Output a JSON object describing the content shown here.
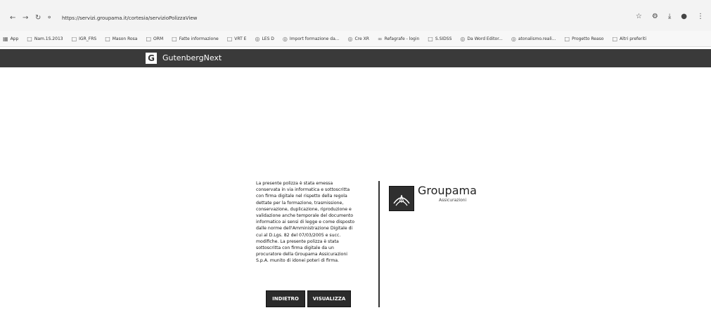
{
  "browser": {
    "url": "https://servizi.groupama.it/cortesia/servizioPolizzaView",
    "bookmarks": [
      {
        "icon": "apps-grid-icon",
        "label": "App"
      },
      {
        "icon": "folder-icon",
        "label": "Nam.1S.2013"
      },
      {
        "icon": "folder-icon",
        "label": "IGR_FRS"
      },
      {
        "icon": "folder-icon",
        "label": "Mason Rosa"
      },
      {
        "icon": "folder-icon",
        "label": "ORM"
      },
      {
        "icon": "folder-icon",
        "label": "Fatte informazione"
      },
      {
        "icon": "folder-icon",
        "label": "VRT E"
      },
      {
        "icon": "globe-icon",
        "label": "LES D"
      },
      {
        "icon": "globe-icon",
        "label": "Import formazione da..."
      },
      {
        "icon": "globe-icon",
        "label": "Cre XR"
      },
      {
        "icon": "link-icon",
        "label": "Refagrafe - login"
      },
      {
        "icon": "folder-icon",
        "label": "S.SIDSS"
      },
      {
        "icon": "globe-icon",
        "label": "Da Word Editor..."
      },
      {
        "icon": "globe-icon",
        "label": "atonalismo.reali..."
      },
      {
        "icon": "folder-icon",
        "label": "Progetto Reaso"
      },
      {
        "icon": "folder-icon",
        "label": "Altri preferiti"
      }
    ]
  },
  "app": {
    "logo_letter": "G",
    "name": "GutenbergNext"
  },
  "notice": {
    "text": "La presente polizza è stata emessa conservata in via informatica e sottoscritta con firma digitale nel rispetto della regola dettate per la formazione, trasmissione, conservazione, duplicazione, riproduzione e validazione anche temporale del documento informatico ai sensi di legge e come disposto dalle norme dell'Amministrazione Digitale di cui al D.Lgs. 82 del 07/03/2005 e succ. modifiche. La presente polizza è stata sottoscritta con firma digitale da un procuratore della Groupama Assicurazioni S.p.A. munito di idonei poteri di firma."
  },
  "buttons": {
    "back": "INDIETRO",
    "view": "VISUALIZZA"
  },
  "brand": {
    "name": "Groupama",
    "subtitle": "Assicurazioni"
  }
}
